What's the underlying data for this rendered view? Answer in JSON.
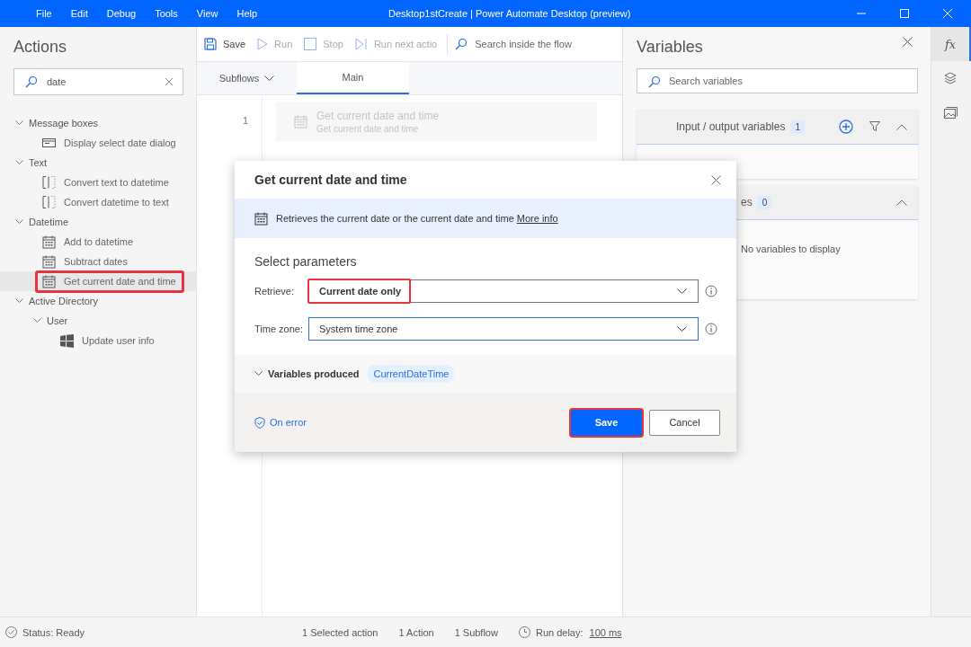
{
  "menu": [
    "File",
    "Edit",
    "Debug",
    "Tools",
    "View",
    "Help"
  ],
  "window": {
    "title": "Desktop1stCreate | Power Automate Desktop (preview)"
  },
  "actions": {
    "title": "Actions",
    "search": {
      "value": "date"
    },
    "tree": [
      {
        "label": "Message boxes",
        "expanded": true,
        "children": [
          {
            "label": "Display select date dialog",
            "kind": "message",
            "selected": false,
            "highlighted": false
          }
        ]
      },
      {
        "label": "Text",
        "expanded": true,
        "children": [
          {
            "label": "Convert text to datetime",
            "kind": "convert",
            "selected": false,
            "highlighted": false
          },
          {
            "label": "Convert datetime to text",
            "kind": "convert",
            "selected": false,
            "highlighted": false
          }
        ]
      },
      {
        "label": "Datetime",
        "expanded": true,
        "children": [
          {
            "label": "Add to datetime",
            "kind": "calendar",
            "selected": false,
            "highlighted": false
          },
          {
            "label": "Subtract dates",
            "kind": "calendar",
            "selected": false,
            "highlighted": false
          },
          {
            "label": "Get current date and time",
            "kind": "calendar",
            "selected": true,
            "highlighted": true
          }
        ]
      },
      {
        "label": "Active Directory",
        "expanded": true,
        "children": [
          {
            "label": "User",
            "expanded": true,
            "children": [
              {
                "label": "Update user info",
                "kind": "windows",
                "selected": false,
                "highlighted": false
              }
            ]
          }
        ]
      }
    ]
  },
  "toolbar": [
    {
      "label": "Save",
      "kind": "save",
      "disabled": false
    },
    {
      "label": "Run",
      "kind": "run",
      "disabled": true
    },
    {
      "label": "Stop",
      "kind": "stop",
      "disabled": true
    },
    {
      "label": "Run next actio",
      "kind": "next",
      "disabled": true
    }
  ],
  "flow_search": {
    "placeholder": "Search inside the flow"
  },
  "tabs": [
    {
      "label": "Subflows",
      "kind": "dropdown",
      "selected": false
    },
    {
      "label": "Main",
      "kind": "tab",
      "selected": true
    }
  ],
  "steps": [
    {
      "number": "1",
      "title": "Get current date and time",
      "subtitle": "Get current date and time",
      "disabled": true
    }
  ],
  "variables": {
    "title": "Variables",
    "search": {
      "placeholder": "Search variables"
    },
    "sections": [
      {
        "title": "Input / output variables",
        "count": "1",
        "expanded": true,
        "kind": "io"
      },
      {
        "title": "es",
        "count": "0",
        "expanded": true,
        "kind": "flow",
        "empty_text": "No variables to display"
      }
    ]
  },
  "rail": [
    {
      "kind": "fx",
      "label": "fx",
      "selected": true
    },
    {
      "kind": "layers",
      "selected": false
    },
    {
      "kind": "images",
      "selected": false
    }
  ],
  "dialog": {
    "title": "Get current date and time",
    "description": "Retrieves the current date or the current date and time",
    "link": "More info",
    "heading": "Select parameters",
    "fields": [
      {
        "label": "Retrieve:",
        "value": "Current date only",
        "highlighted": true,
        "focused": false
      },
      {
        "label": "Time zone:",
        "value": "System time zone",
        "highlighted": false,
        "focused": true
      }
    ],
    "variables_produced": {
      "label": "Variables produced",
      "expanded": true,
      "chips": [
        "CurrentDateTime"
      ]
    },
    "on_error": "On error",
    "buttons": [
      {
        "label": "Save",
        "primary": true,
        "highlighted": true
      },
      {
        "label": "Cancel",
        "primary": false,
        "highlighted": false
      }
    ]
  },
  "status_bar": {
    "status": "Status: Ready",
    "items": [
      "1 Selected action",
      "1 Action",
      "1 Subflow"
    ],
    "delay_label": "Run delay:",
    "delay_value": "100 ms"
  }
}
